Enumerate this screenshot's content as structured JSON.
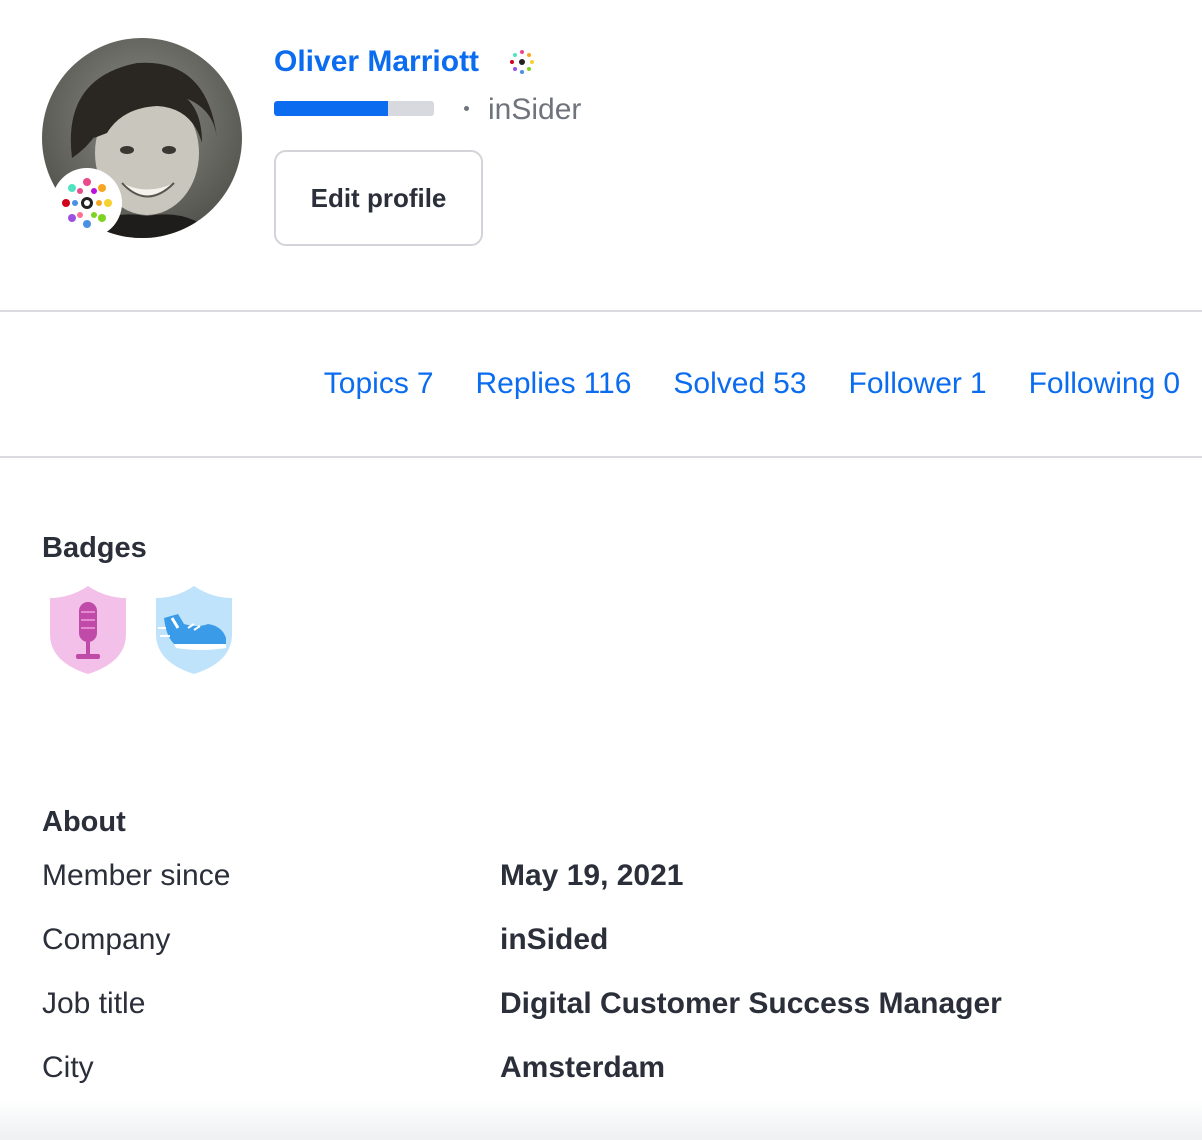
{
  "profile": {
    "name": "Oliver Marriott",
    "rank": "inSider",
    "rank_progress_percent": 71,
    "edit_label": "Edit profile",
    "avatar_icon": "avatar-photo",
    "rank_icon": "insider-rank-icon"
  },
  "stats": [
    {
      "label": "Topics",
      "value": "7"
    },
    {
      "label": "Replies",
      "value": "116"
    },
    {
      "label": "Solved",
      "value": "53"
    },
    {
      "label": "Follower",
      "value": "1"
    },
    {
      "label": "Following",
      "value": "0"
    }
  ],
  "badges": {
    "title": "Badges",
    "items": [
      {
        "icon": "microphone-badge-icon",
        "color": "#f2c0e8"
      },
      {
        "icon": "sneaker-badge-icon",
        "color": "#bfe3fb"
      }
    ]
  },
  "about": {
    "title": "About",
    "rows": [
      {
        "label": "Member since",
        "value": "May 19, 2021"
      },
      {
        "label": "Company",
        "value": "inSided"
      },
      {
        "label": "Job title",
        "value": "Digital Customer Success Manager"
      },
      {
        "label": "City",
        "value": "Amsterdam"
      }
    ]
  },
  "colors": {
    "accent": "#0b6cf0",
    "text": "#2b2f3a",
    "muted": "#6f737c",
    "divider": "#d9dbe0"
  }
}
